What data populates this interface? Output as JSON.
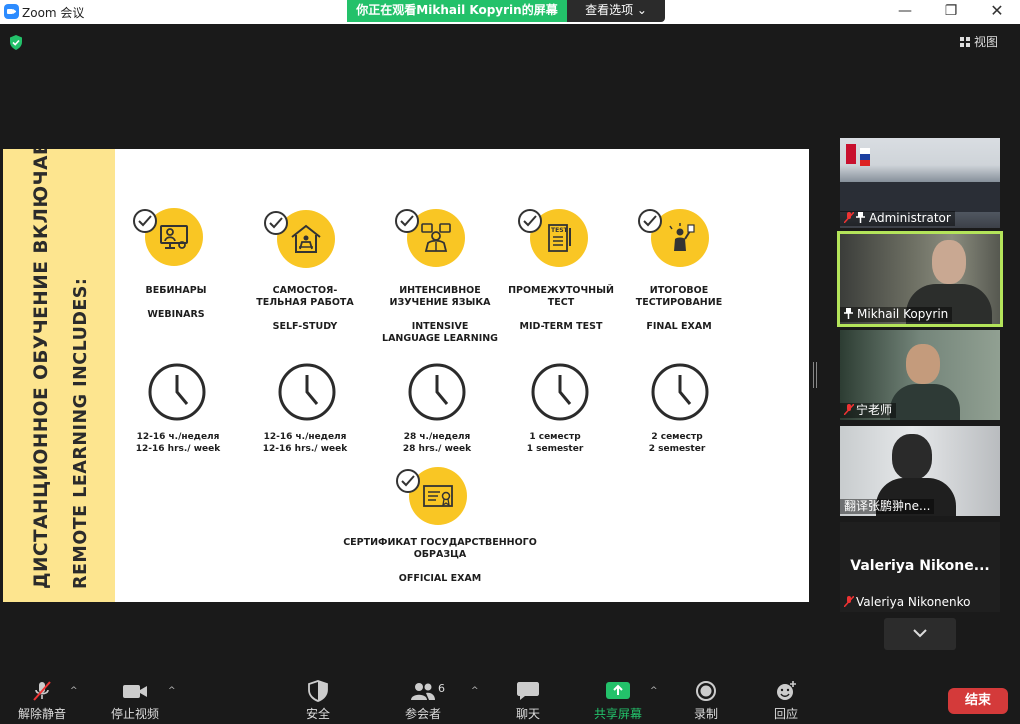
{
  "window": {
    "title": "Zoom 会议"
  },
  "banner": {
    "sharing_text": "你正在观看Mikhail Kopyrin的屏幕",
    "view_options": "查看选项 ⌄"
  },
  "view_button": "视图",
  "slide": {
    "vertical_title_ru": "ДИСТАНЦИОННОЕ ОБУЧЕНИЕ ВКЛЮЧАЕТ:",
    "vertical_title_en": "REMOTE LEARNING INCLUDES:",
    "items": [
      {
        "ru": "ВЕБИНАРЫ",
        "en": "WEBINARS",
        "hours_ru": "12-16 ч./неделя",
        "hours_en": "12-16 hrs./ week"
      },
      {
        "ru": "САМОСТОЯ-\nТЕЛЬНАЯ РАБОТА",
        "en": "SELF-STUDY",
        "hours_ru": "12-16 ч./неделя",
        "hours_en": "12-16 hrs./ week"
      },
      {
        "ru": "ИНТЕНСИВНОЕ\nИЗУЧЕНИЕ ЯЗЫКА",
        "en": "INTENSIVE\nLANGUAGE LEARNING",
        "hours_ru": "28 ч./неделя",
        "hours_en": "28 hrs./ week"
      },
      {
        "ru": "ПРОМЕЖУТОЧНЫЙ\nТЕСТ",
        "en": "MID-TERM TEST",
        "hours_ru": "1 семестр",
        "hours_en": "1 semester"
      },
      {
        "ru": "ИТОГОВОЕ\nТЕСТИРОВАНИЕ",
        "en": "FINAL EXAM",
        "hours_ru": "2 семестр",
        "hours_en": "2 semester"
      }
    ],
    "certificate_ru": "СЕРТИФИКАТ ГОСУДАРСТВЕННОГО\nОБРАЗЦА",
    "certificate_en": "OFFICIAL EXAM",
    "test_icon_text": "TEST"
  },
  "participants": [
    {
      "name": "Administrator",
      "muted": true,
      "pinned": true
    },
    {
      "name": "Mikhail Kopyrin",
      "muted": false,
      "pinned": true,
      "active": true
    },
    {
      "name": "宁老师",
      "muted": true
    },
    {
      "name": "翻译张鹏翀ne...",
      "muted": false
    },
    {
      "name": "Valeriya Nikonenko",
      "display_name": "Valeriya  Nikone...",
      "muted": true
    }
  ],
  "toolbar": {
    "unmute": "解除静音",
    "stop_video": "停止视频",
    "security": "安全",
    "participants": "参会者",
    "participant_count": "6",
    "chat": "聊天",
    "share_screen": "共享屏幕",
    "record": "录制",
    "reactions": "回应",
    "end": "结束"
  },
  "colors": {
    "accent_green": "#23c16a",
    "slide_yellow": "#f9c624",
    "side_yellow": "#fde58f",
    "end_red": "#d43a3a",
    "active_outline": "#b4e45a"
  }
}
